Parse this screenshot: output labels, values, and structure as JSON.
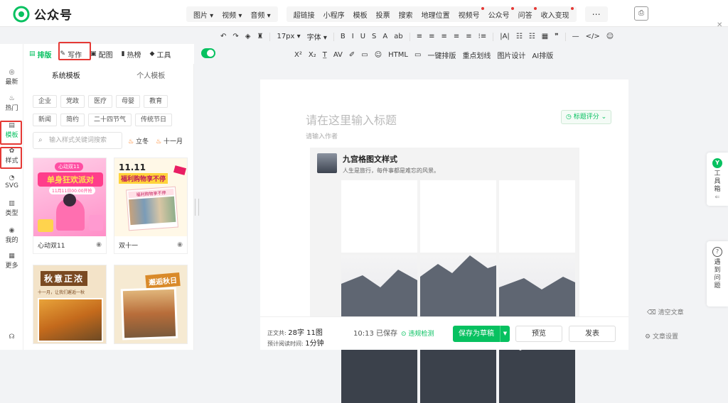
{
  "app": {
    "name": "公众号",
    "accent": "#07c160"
  },
  "topmenu": {
    "group1": [
      "图片",
      "视频",
      "音频"
    ],
    "group2": [
      {
        "label": "超链接",
        "dot": false
      },
      {
        "label": "小程序",
        "dot": false
      },
      {
        "label": "模板",
        "dot": false
      },
      {
        "label": "投票",
        "dot": false
      },
      {
        "label": "搜索",
        "dot": false
      },
      {
        "label": "地理位置",
        "dot": false
      },
      {
        "label": "视频号",
        "dot": true
      },
      {
        "label": "公众号",
        "dot": true
      },
      {
        "label": "问答",
        "dot": true
      },
      {
        "label": "收入变现",
        "dot": true
      }
    ],
    "more": "⋯"
  },
  "rail": [
    {
      "icon": "chat-icon",
      "glyph": "◎",
      "label": "最新"
    },
    {
      "icon": "flame-icon",
      "glyph": "♨",
      "label": "热门"
    },
    {
      "icon": "template-icon",
      "glyph": "▤",
      "label": "模板"
    },
    {
      "icon": "style-icon",
      "glyph": "✿",
      "label": "样式"
    },
    {
      "icon": "svg-icon",
      "glyph": "◔",
      "label": "SVG"
    },
    {
      "icon": "category-icon",
      "glyph": "▥",
      "label": "类型"
    },
    {
      "icon": "user-icon",
      "glyph": "◉",
      "label": "我的"
    },
    {
      "icon": "grid-icon",
      "glyph": "▦",
      "label": "更多"
    },
    {
      "icon": "headset-icon",
      "glyph": "☊",
      "label": ""
    }
  ],
  "tabs": [
    {
      "label": "排版",
      "glyph": "▤",
      "active": true
    },
    {
      "label": "写作",
      "glyph": "✎",
      "active": false
    },
    {
      "label": "配图",
      "glyph": "▣",
      "active": false
    },
    {
      "label": "热榜",
      "glyph": "▮",
      "active": false
    },
    {
      "label": "工具",
      "glyph": "◆",
      "active": false
    }
  ],
  "panel": {
    "subtabs": [
      "系统模板",
      "个人模板"
    ],
    "chips_row1": [
      "企业",
      "党政",
      "医疗",
      "母婴",
      "教育"
    ],
    "chips_row2": [
      "新闻",
      "简约",
      "二十四节气",
      "传统节日"
    ],
    "search_placeholder": "输入样式关键词搜索",
    "hot_tags": [
      "立冬",
      "十一月"
    ],
    "cards": [
      {
        "name": "心动双11",
        "line1": "心动双11",
        "line2": "单身狂欢派对",
        "line3": "11月11日00:00开抢"
      },
      {
        "name": "双十一",
        "line1": "11.11",
        "line2": "福利购物享不停",
        "line3": "福利购物享不停"
      },
      {
        "name": "秋意正浓",
        "line1": "秋意正浓",
        "line2": "十一月，让我们邂逅一秋",
        "line3": ""
      },
      {
        "name": "邂逅秋日",
        "line1": "邂逅秋日",
        "line2": "",
        "line3": ""
      }
    ]
  },
  "toolbar1": [
    "↶",
    "↷",
    "◈",
    "♜",
    "17px",
    "字体",
    "B",
    "I",
    "U",
    "S",
    "A",
    "ab",
    "≡",
    "≡",
    "≡",
    "≡",
    "≡",
    "⁝≡",
    "|A|",
    "☷",
    "☷",
    "▦",
    "❞",
    "—",
    "</>",
    "☺"
  ],
  "toolbar2": [
    "X²",
    "X₂",
    "T̲",
    "AV",
    "✐",
    "▭",
    "☺",
    "HTML",
    "▭",
    "一键排版",
    "重点划线",
    "图片设计",
    "AI排版"
  ],
  "editor": {
    "title_placeholder": "请在这里输入标题",
    "author_placeholder": "请输入作者",
    "score_label": "标题评分",
    "article_title": "九宫格图文样式",
    "article_sub": "人生是旅行，每件事都是难忘的风景。"
  },
  "footer": {
    "wordcount_label": "正文共:",
    "wordcount_value": "28字 11图",
    "readtime_label": "预计阅读时间:",
    "readtime_value": "1分钟",
    "saved": "10:13 已保存",
    "violation": "违规检测",
    "save_draft": "保存为草稿",
    "preview": "预览",
    "publish": "发表"
  },
  "side": {
    "clear": "清空文章",
    "settings": "文章设置",
    "toolbox": "工具箱",
    "issue": "遇到问题"
  }
}
